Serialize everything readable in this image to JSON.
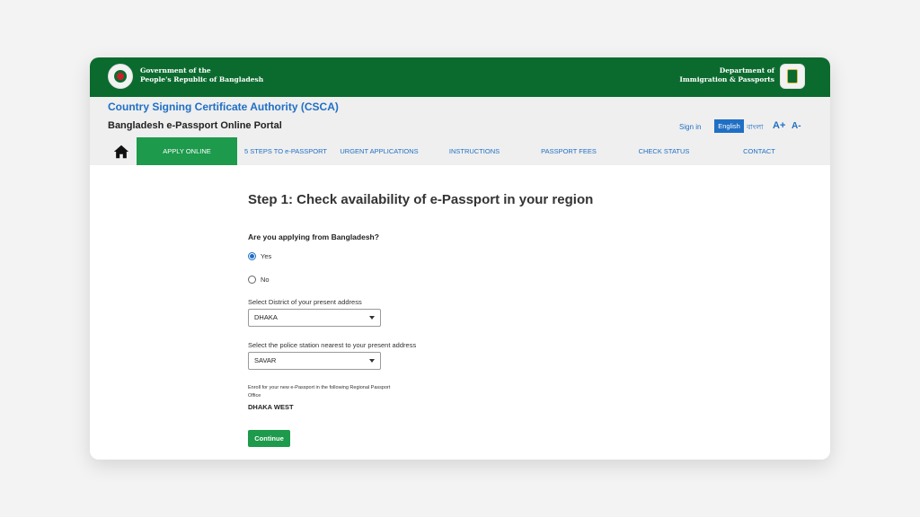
{
  "gov_header": {
    "left_line1": "Government of the",
    "left_line2": "People's Republic of Bangladesh",
    "right_line1": "Department of",
    "right_line2": "Immigration & Passports"
  },
  "site": {
    "csca_title": "Country Signing Certificate Authority (CSCA)",
    "portal_title": "Bangladesh e-Passport Online Portal",
    "sign_in": "Sign in",
    "lang_english": "English",
    "lang_bangla": "বাংলা",
    "font_increase": "A+",
    "font_decrease": "A-"
  },
  "nav": {
    "home_icon": "home-icon",
    "items": [
      {
        "label": "APPLY ONLINE",
        "active": true
      },
      {
        "label": "5 STEPS TO e-PASSPORT"
      },
      {
        "label": "URGENT APPLICATIONS"
      },
      {
        "label": "INSTRUCTIONS"
      },
      {
        "label": "PASSPORT FEES"
      },
      {
        "label": "CHECK STATUS"
      },
      {
        "label": "CONTACT"
      }
    ]
  },
  "form": {
    "step_title": "Step 1: Check availability of e-Passport in your region",
    "question": "Are you applying from Bangladesh?",
    "option_yes": "Yes",
    "option_no": "No",
    "selected_option": "Yes",
    "district_label": "Select District of your present address",
    "district_value": "DHAKA",
    "police_label": "Select the police station nearest to your present address",
    "police_value": "SAVAR",
    "enroll_note": "Enroll for your new e-Passport in the following Regional Passport Office",
    "office_value": "DHAKA WEST",
    "continue_label": "Continue"
  },
  "colors": {
    "header_green": "#0b6b2e",
    "accent_green": "#1d9a4c",
    "link_blue": "#1f6fc5"
  }
}
